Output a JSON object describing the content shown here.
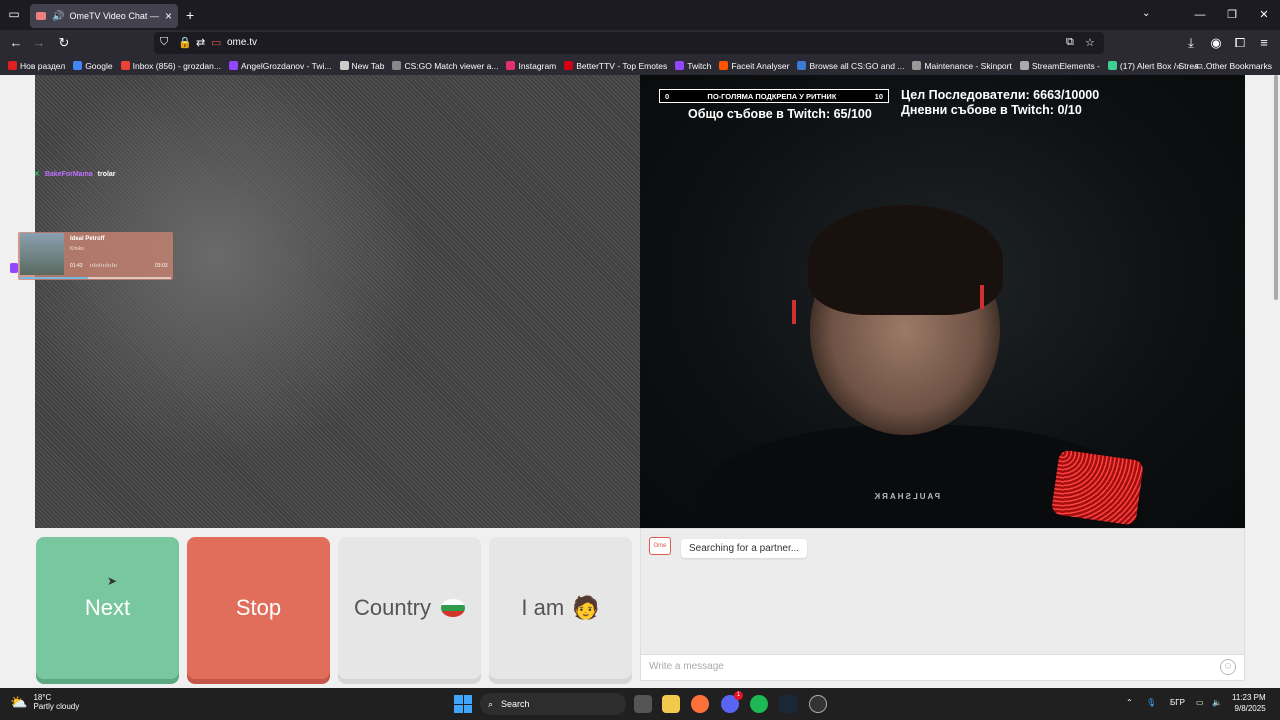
{
  "browser": {
    "tab_title": "OmeTV Video Chat — Ome",
    "url": "ome.tv",
    "bookmarks": [
      {
        "label": "Нов раздел",
        "color": "#e02020"
      },
      {
        "label": "Google",
        "color": "#4285f4"
      },
      {
        "label": "Inbox (856) - grozdan...",
        "color": "#ea4335"
      },
      {
        "label": "AngelGrozdanov - Twi...",
        "color": "#9146ff"
      },
      {
        "label": "New Tab",
        "color": "#cccccc"
      },
      {
        "label": "CS:GO Match viewer a...",
        "color": "#888888"
      },
      {
        "label": "Instagram",
        "color": "#e1306c"
      },
      {
        "label": "BetterTTV - Top Emotes",
        "color": "#d50014"
      },
      {
        "label": "Twitch",
        "color": "#9146ff"
      },
      {
        "label": "Faceit Analyser",
        "color": "#ff5500"
      },
      {
        "label": "Browse all CS:GO and ...",
        "color": "#3a7bd5"
      },
      {
        "label": "Maintenance - Skinport",
        "color": "#999999"
      },
      {
        "label": "StreamElements -",
        "color": "#aaaaaa"
      },
      {
        "label": "(17) Alert Box / Strea...",
        "color": "#3ccf91"
      }
    ],
    "other_bookmarks": "Other Bookmarks"
  },
  "stream_overlay": {
    "chat_user": "BakeForMama",
    "chat_message": "trolar",
    "music_title": "Ideal Petroff",
    "music_artist": "Krisko",
    "music_elapsed": "01:43",
    "music_total": "03:03",
    "music_progress": 0.45,
    "goal_min": "0",
    "goal_label": "ПО-ГОЛЯМА ПОДКРЕПА У РИТНИК",
    "goal_max": "10",
    "twitch_total": "Общо събове в Twitch: 65/100",
    "followers_goal": "Цел Последователи: 6663/10000",
    "daily_subs": "Дневни събове в Twitch: 0/10",
    "shirt_text": "PAULSHARK"
  },
  "controls": {
    "next_label": "Next",
    "stop_label": "Stop",
    "country_label": "Country",
    "iam_label": "I am",
    "iam_emoji": "🧑"
  },
  "chat": {
    "logo_text": "Ome",
    "status": "Searching for a partner...",
    "placeholder": "Write a message"
  },
  "taskbar": {
    "temperature": "18°C",
    "weather": "Partly cloudy",
    "search_label": "Search",
    "language": "БГР",
    "time": "11:23 PM",
    "date": "9/8/2025",
    "discord_badge": "1"
  }
}
